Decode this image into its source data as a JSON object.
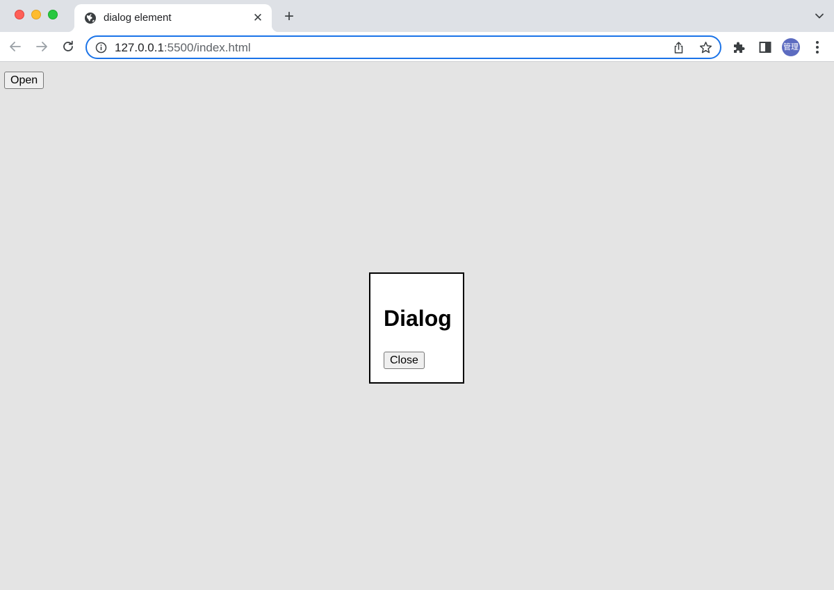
{
  "browser": {
    "tab": {
      "title": "dialog element"
    },
    "tab_close_glyph": "✕",
    "new_tab_glyph": "+",
    "address": {
      "host": "127.0.0.1",
      "port_path": ":5500/index.html"
    },
    "profile_avatar_text": "管理",
    "colors": {
      "focus_ring": "#1a73e8",
      "avatar_bg": "#5c6bc0"
    }
  },
  "page": {
    "open_button_label": "Open",
    "dialog": {
      "title": "Dialog",
      "close_button_label": "Close"
    }
  }
}
